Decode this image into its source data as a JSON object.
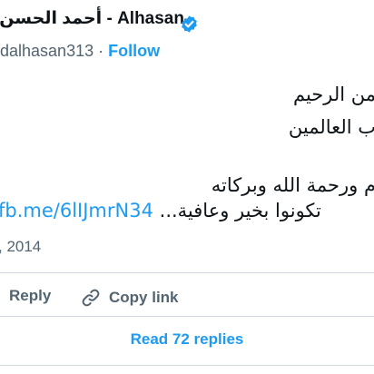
{
  "author": {
    "display_name": "أحمد الحسن - Alhasan",
    "handle": "dalhasan313",
    "separator": "·",
    "follow_label": "Follow"
  },
  "tweet": {
    "lines": [
      "من الرحيم",
      "ب العالمين",
      "م ورحمة الله وبركاته"
    ],
    "last_line_link": "fb.me/6lIJmrN34",
    "last_line_text": "تكونوا بخير وعافية..."
  },
  "meta": {
    "date": ", 2014"
  },
  "actions": {
    "reply_label": "Reply",
    "copy_link_label": "Copy link",
    "read_replies_label": "Read 72 replies"
  },
  "colors": {
    "accent": "#1d9bf0",
    "text": "#0f1419",
    "muted": "#536471",
    "divider": "#cfd9de"
  }
}
